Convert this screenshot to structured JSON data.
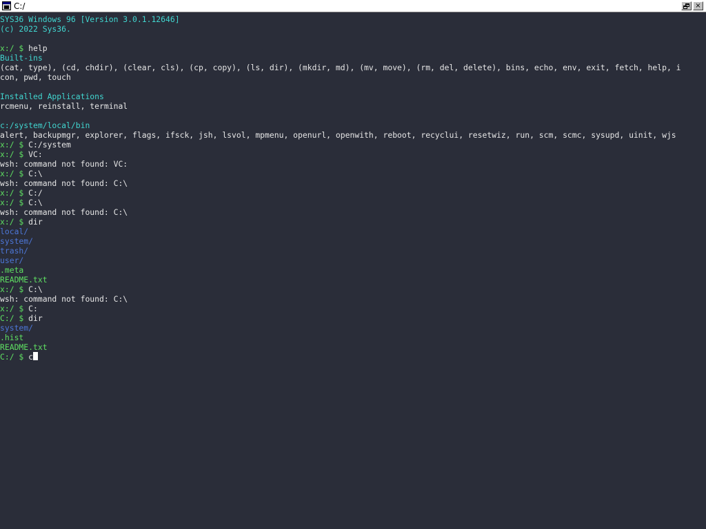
{
  "window": {
    "title": "C:/",
    "restore_symbol": "",
    "close_symbol": "×"
  },
  "colors": {
    "background": "#2a2d39",
    "cyan": "#41d6d0",
    "green": "#5fe062",
    "blue": "#4d77d8",
    "text": "#e6e6e6"
  },
  "terminal": {
    "lines": [
      {
        "text": "SYS36 Windows 96 [Version 3.0.1.12646]",
        "color": "cyan"
      },
      {
        "text": "(c) 2022 Sys36.",
        "color": "cyan"
      },
      {
        "text": "",
        "color": "white"
      },
      {
        "prompt": "x:/ $ ",
        "text": "help"
      },
      {
        "text": "Built-ins",
        "color": "cyan"
      },
      {
        "text": "(cat, type), (cd, chdir), (clear, cls), (cp, copy), (ls, dir), (mkdir, md), (mv, move), (rm, del, delete), bins, echo, env, exit, fetch, help, i",
        "color": "white"
      },
      {
        "text": "con, pwd, touch",
        "color": "white"
      },
      {
        "text": "",
        "color": "white"
      },
      {
        "text": "Installed Applications",
        "color": "cyan"
      },
      {
        "text": "rcmenu, reinstall, terminal",
        "color": "white"
      },
      {
        "text": "",
        "color": "white"
      },
      {
        "text": "c:/system/local/bin",
        "color": "cyan"
      },
      {
        "text": "alert, backupmgr, explorer, flags, ifsck, jsh, lsvol, mpmenu, openurl, openwith, reboot, recyclui, resetwiz, run, scm, scmc, sysupd, uinit, wjs",
        "color": "white"
      },
      {
        "prompt": "x:/ $ ",
        "text": "C:/system"
      },
      {
        "prompt": "x:/ $ ",
        "text": "VC:"
      },
      {
        "text": "wsh: command not found: VC:",
        "color": "white"
      },
      {
        "prompt": "x:/ $ ",
        "text": "C:\\"
      },
      {
        "text": "wsh: command not found: C:\\",
        "color": "white"
      },
      {
        "prompt": "x:/ $ ",
        "text": "C:/"
      },
      {
        "prompt": "x:/ $ ",
        "text": "C:\\"
      },
      {
        "text": "wsh: command not found: C:\\",
        "color": "white"
      },
      {
        "prompt": "x:/ $ ",
        "text": "dir"
      },
      {
        "text": "local/",
        "color": "blue"
      },
      {
        "text": "system/",
        "color": "blue"
      },
      {
        "text": "trash/",
        "color": "blue"
      },
      {
        "text": "user/",
        "color": "blue"
      },
      {
        "text": ".meta",
        "color": "green"
      },
      {
        "text": "README.txt",
        "color": "green"
      },
      {
        "prompt": "x:/ $ ",
        "text": "C:\\"
      },
      {
        "text": "wsh: command not found: C:\\",
        "color": "white"
      },
      {
        "prompt": "x:/ $ ",
        "text": "C:"
      },
      {
        "prompt": "C:/ $ ",
        "text": "dir"
      },
      {
        "text": "system/",
        "color": "blue"
      },
      {
        "text": ".hist",
        "color": "green"
      },
      {
        "text": "README.txt",
        "color": "green"
      }
    ],
    "input_line": {
      "prompt": "C:/ $ ",
      "text": "c"
    }
  }
}
